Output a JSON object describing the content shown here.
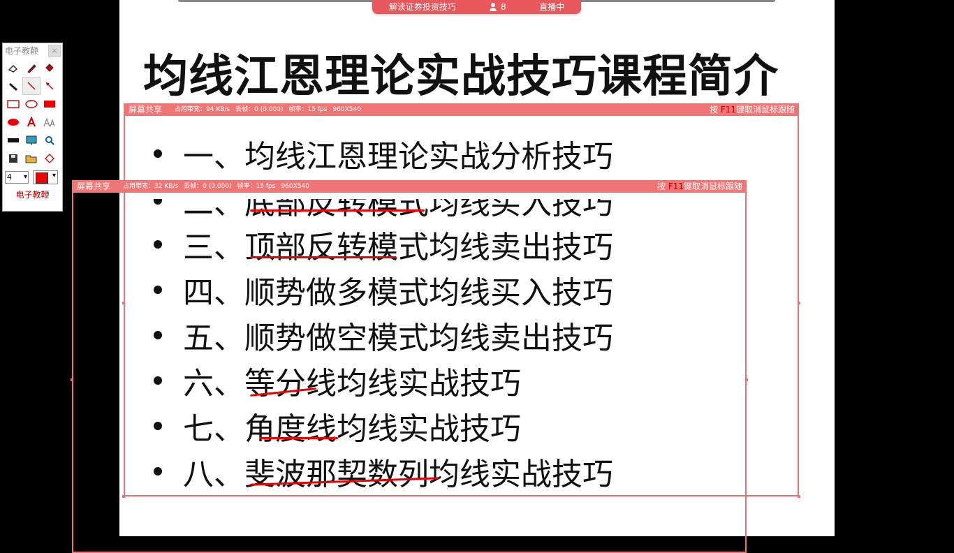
{
  "live_bar": {
    "title": "解读证券投资技巧",
    "viewer_count": "8",
    "status": "直播中"
  },
  "slide": {
    "title": "均线江恩理论实战技巧课程简介",
    "items": [
      "一、均线江恩理论实战分析技巧",
      "二、底部反转模式均线买入技巧",
      "三、顶部反转模式均线卖出技巧",
      "四、顺势做多模式均线买入技巧",
      "五、顺势做空模式均线卖出技巧",
      "六、等分线均线实战技巧",
      "七、角度线均线实战技巧",
      "八、斐波那契数列均线实战技巧"
    ]
  },
  "share_frame_outer": {
    "label": "屏幕共享",
    "bandwidth": "占用带宽：94 KB/s",
    "dropped": "丢帧：0 (0.000)",
    "fps": "帧率：15 fps",
    "resolution": "960X540",
    "hint_pre": "按 ",
    "hint_key": "F11",
    "hint_post": "键取消鼠标跟随"
  },
  "share_frame_inner": {
    "label": "屏幕共享",
    "bandwidth": "占用带宽：32 KB/s",
    "dropped": "丢帧：0 (0.000)",
    "fps": "帧率：15 fps",
    "resolution": "960X540",
    "hint_pre": "按 ",
    "hint_key": "F11",
    "hint_post": "键取消鼠标跟随"
  },
  "toolbox": {
    "title": "电子教鞭",
    "close": "×",
    "tools": [
      "eraser-icon",
      "pen-icon",
      "fill-icon",
      "marker-icon",
      "line-icon",
      "arrow-icon",
      "rectangle-icon",
      "ellipse-icon",
      "filled-rectangle-icon",
      "filled-ellipse-icon",
      "text-icon",
      "font-size-icon",
      "black-bar-icon",
      "screen-icon",
      "zoom-icon",
      "save-icon",
      "open-icon",
      "diamond-icon"
    ],
    "size_value": "4",
    "pen_color": "#e00000",
    "caption": "电子教鞭"
  },
  "colors": {
    "accent": "#e8575c",
    "frame": "#f07070",
    "underline": "#e00000"
  }
}
